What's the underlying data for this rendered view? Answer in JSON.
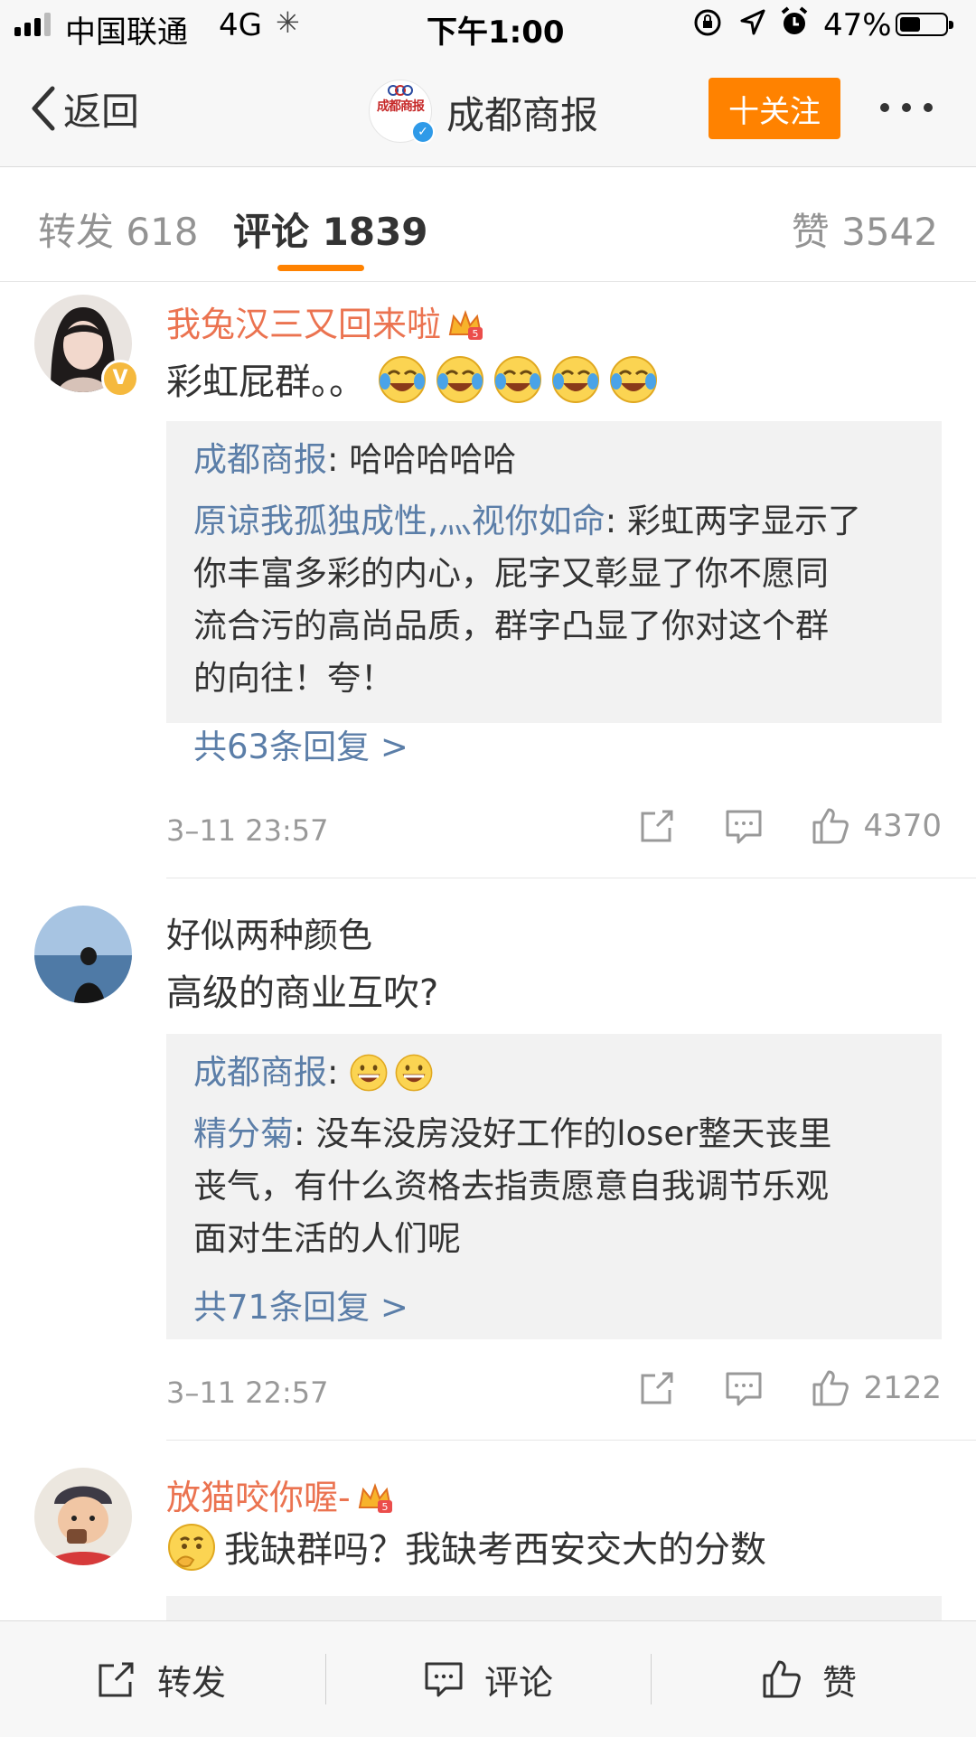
{
  "status_bar": {
    "carrier": "中国联通",
    "network": "4G",
    "time": "下午1:00",
    "battery_percent": "47%",
    "battery_level": 0.47
  },
  "nav": {
    "back_label": "返回",
    "account_name": "成都商报",
    "avatar_logo_text": "成都商报",
    "follow_label": "十关注"
  },
  "tabs": {
    "repost": "转发 618",
    "comment": "评论 1839",
    "like": "赞 3542"
  },
  "comments": [
    {
      "username": "我兔汉三又回来啦",
      "username_style": "vip",
      "verified": true,
      "verified_mark": "V",
      "text": "彩虹屁群。。",
      "emoji": "laughing-tears",
      "emoji_count": 5,
      "replies": [
        {
          "user": "成都商报",
          "text": ": 哈哈哈哈哈"
        },
        {
          "user": "原谅我孤独成性,灬视你如命",
          "text": ": 彩虹两字显示了"
        },
        {
          "user": "",
          "text": "你丰富多彩的内心，屁字又彰显了你不愿同"
        },
        {
          "user": "",
          "text": "流合污的高尚品质，群字凸显了你对这个群"
        },
        {
          "user": "",
          "text": "的向往！夸！"
        }
      ],
      "more_replies": "共63条回复 >",
      "time": "3–11 23:57",
      "like_count": "4370"
    },
    {
      "username": "好似两种颜色",
      "username_style": "plain",
      "verified": false,
      "text": "高级的商业互吹?",
      "replies": [
        {
          "user": "成都商报",
          "text": ":",
          "emoji": "grin",
          "emoji_count": 2
        },
        {
          "user": "精分菊",
          "text": ": 没车没房没好工作的loser整天丧里"
        },
        {
          "user": "",
          "text": "丧气，有什么资格去指责愿意自我调节乐观"
        },
        {
          "user": "",
          "text": "面对生活的人们呢"
        }
      ],
      "more_replies": "共71条回复 >",
      "time": "3–11 22:57",
      "like_count": "2122"
    },
    {
      "username": "放猫咬你喔-",
      "username_style": "vip",
      "verified": false,
      "text": "我缺群吗？我缺考西安交大的分数",
      "emoji": "thinking"
    }
  ],
  "toolbar": {
    "repost": "转发",
    "comment": "评论",
    "like": "赞"
  },
  "colors": {
    "accent": "#ff8200",
    "vip_name": "#eb7350",
    "link": "#5b7ea8",
    "reply_bg": "#f2f2f2",
    "meta": "#999999"
  }
}
